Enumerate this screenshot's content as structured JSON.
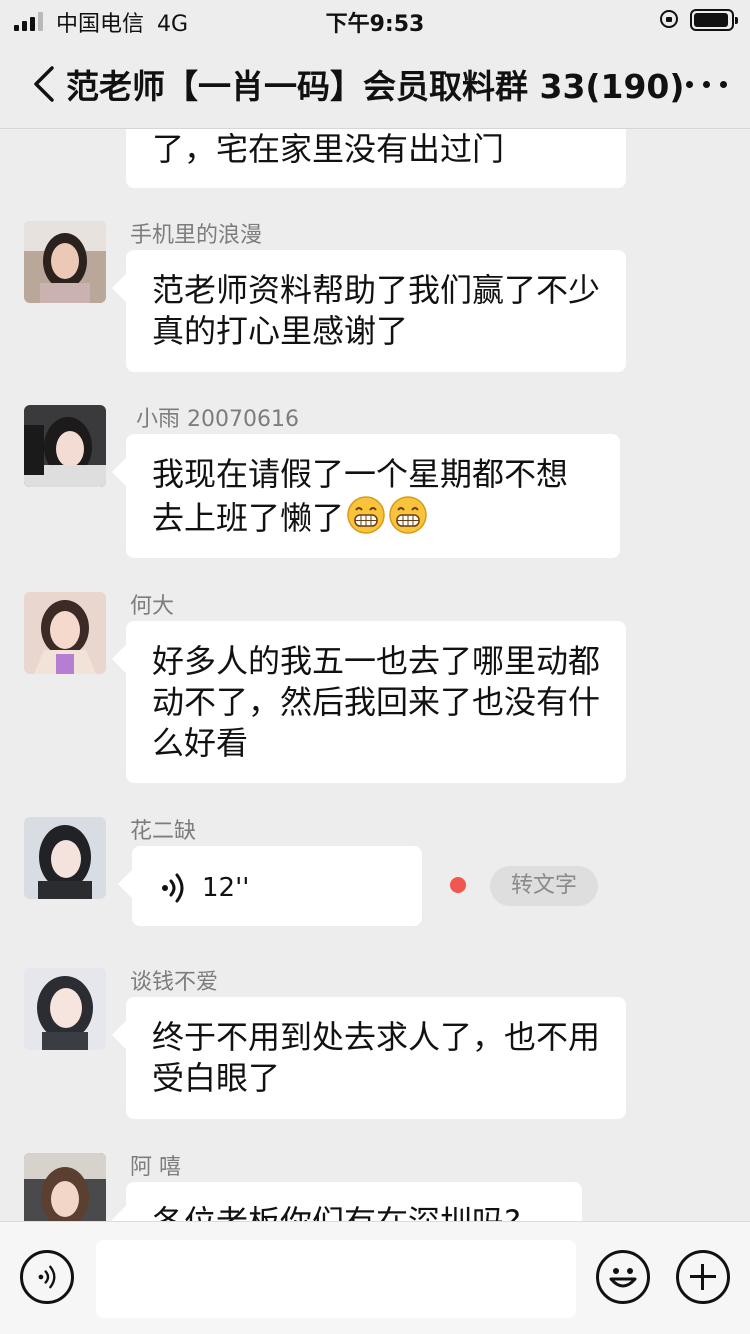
{
  "status_bar": {
    "carrier": "中国电信",
    "network": "4G",
    "time": "下午9:53"
  },
  "header": {
    "title": "范老师【一肖一码】会员取料群 33(190)"
  },
  "messages": [
    {
      "type": "text",
      "text": "了，宅在家里没有出过门"
    },
    {
      "type": "text",
      "sender": "手机里的浪漫",
      "text": "范老师资料帮助了我们赢了不少真的打心里感谢了"
    },
    {
      "type": "text",
      "sender": "小雨 20070616",
      "text": "我现在请假了一个星期都不想去上班了懒了",
      "emoji": [
        "grin-emoji",
        "grin-emoji"
      ]
    },
    {
      "type": "text",
      "sender": "何大",
      "text": "好多人的我五一也去了哪里动都动不了，然后我回来了也没有什么好看"
    },
    {
      "type": "voice",
      "sender": "花二缺",
      "duration": "12''",
      "unread": true,
      "transcribe_label": "转文字"
    },
    {
      "type": "text",
      "sender": "谈钱不爱",
      "text": "终于不用到处去求人了，也不用受白眼了"
    },
    {
      "type": "text",
      "sender": "阿 嘻",
      "text": "各位老板你们有在深圳吗?"
    }
  ],
  "input": {
    "placeholder": ""
  },
  "colors": {
    "background": "#ededed",
    "bubble": "#ffffff",
    "unread_dot": "#f0584f"
  }
}
